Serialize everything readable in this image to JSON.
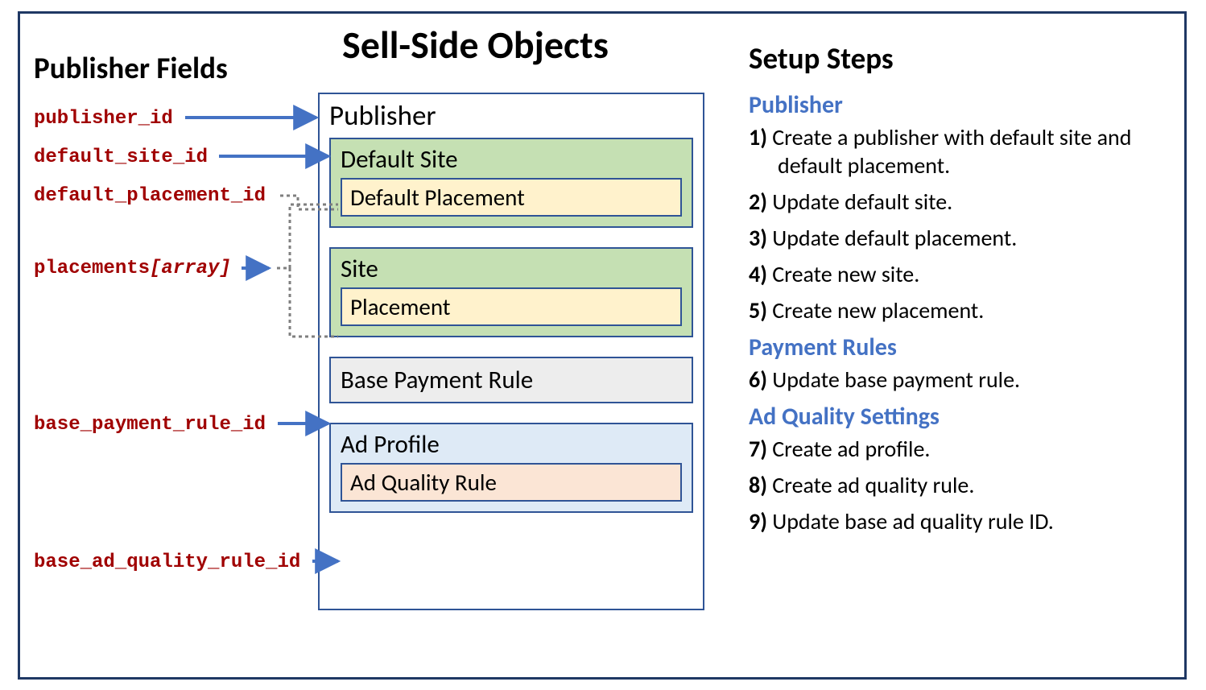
{
  "title": "Sell-Side Objects",
  "left_heading": "Publisher Fields",
  "right_heading": "Setup Steps",
  "fields": {
    "publisher_id": "publisher_id",
    "default_site_id": "default_site_id",
    "default_placement_id": "default_placement_id",
    "placements_array": "placements",
    "placements_array_suffix": "[array]",
    "base_payment_rule_id": "base_payment_rule_id",
    "base_ad_quality_rule_id": "base_ad_quality_rule_id"
  },
  "objects": {
    "publisher": "Publisher",
    "default_site": "Default Site",
    "default_placement": "Default Placement",
    "site": "Site",
    "placement": "Placement",
    "base_payment_rule": "Base Payment Rule",
    "ad_profile": "Ad Profile",
    "ad_quality_rule": "Ad Quality Rule"
  },
  "steps": {
    "section_publisher": "Publisher",
    "section_payment": "Payment Rules",
    "section_adquality": "Ad Quality Settings",
    "s1_num": "1)",
    "s1": " Create a publisher with default site and default placement.",
    "s2_num": "2)",
    "s2": " Update default site.",
    "s3_num": "3)",
    "s3": " Update default placement.",
    "s4_num": "4)",
    "s4": " Create new site.",
    "s5_num": "5)",
    "s5": " Create new placement.",
    "s6_num": "6)",
    "s6": " Update base payment rule.",
    "s7_num": "7)",
    "s7": " Create ad profile.",
    "s8_num": "8)",
    "s8": " Create ad quality rule.",
    "s9_num": "9)",
    "s9": " Update base ad quality rule ID."
  }
}
